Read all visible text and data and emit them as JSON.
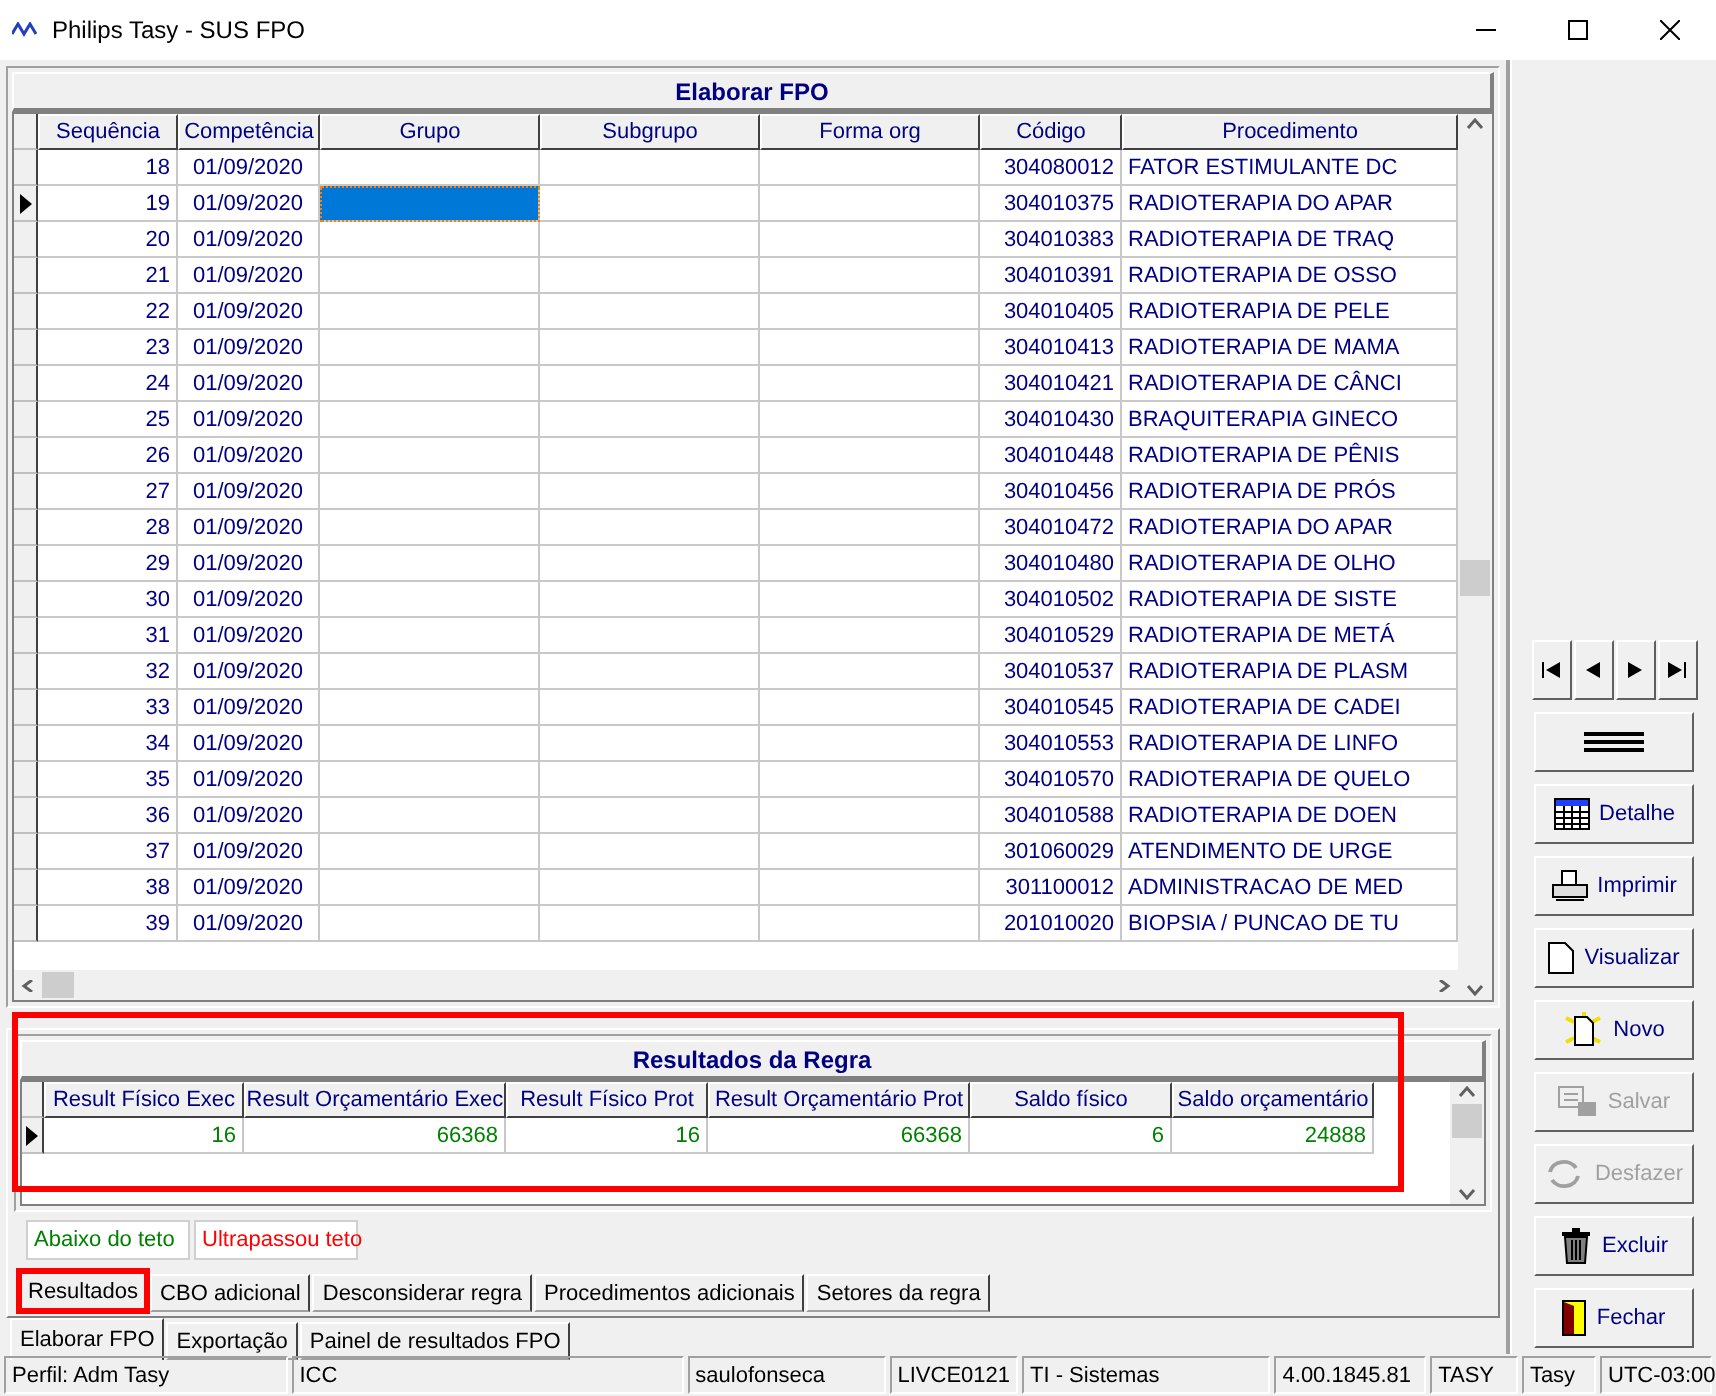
{
  "window": {
    "title": "Philips Tasy - SUS FPO"
  },
  "main_grid": {
    "title": "Elaborar FPO",
    "columns": [
      "Sequência",
      "Competência",
      "Grupo",
      "Subgrupo",
      "Forma org",
      "Código",
      "Procedimento"
    ],
    "rows": [
      {
        "seq": "18",
        "comp": "01/09/2020",
        "code": "304080012",
        "proc": "FATOR ESTIMULANTE DC",
        "current": false
      },
      {
        "seq": "19",
        "comp": "01/09/2020",
        "code": "304010375",
        "proc": "RADIOTERAPIA DO APAR",
        "current": true
      },
      {
        "seq": "20",
        "comp": "01/09/2020",
        "code": "304010383",
        "proc": "RADIOTERAPIA DE TRAQ",
        "current": false
      },
      {
        "seq": "21",
        "comp": "01/09/2020",
        "code": "304010391",
        "proc": "RADIOTERAPIA DE OSSO",
        "current": false
      },
      {
        "seq": "22",
        "comp": "01/09/2020",
        "code": "304010405",
        "proc": "RADIOTERAPIA DE PELE",
        "current": false
      },
      {
        "seq": "23",
        "comp": "01/09/2020",
        "code": "304010413",
        "proc": "RADIOTERAPIA DE MAMA",
        "current": false
      },
      {
        "seq": "24",
        "comp": "01/09/2020",
        "code": "304010421",
        "proc": "RADIOTERAPIA DE CÂNCI",
        "current": false
      },
      {
        "seq": "25",
        "comp": "01/09/2020",
        "code": "304010430",
        "proc": "BRAQUITERAPIA GINECO",
        "current": false
      },
      {
        "seq": "26",
        "comp": "01/09/2020",
        "code": "304010448",
        "proc": "RADIOTERAPIA DE PÊNIS",
        "current": false
      },
      {
        "seq": "27",
        "comp": "01/09/2020",
        "code": "304010456",
        "proc": "RADIOTERAPIA DE PRÓS",
        "current": false
      },
      {
        "seq": "28",
        "comp": "01/09/2020",
        "code": "304010472",
        "proc": "RADIOTERAPIA DO APAR",
        "current": false
      },
      {
        "seq": "29",
        "comp": "01/09/2020",
        "code": "304010480",
        "proc": "RADIOTERAPIA DE OLHO",
        "current": false
      },
      {
        "seq": "30",
        "comp": "01/09/2020",
        "code": "304010502",
        "proc": "RADIOTERAPIA DE SISTE",
        "current": false
      },
      {
        "seq": "31",
        "comp": "01/09/2020",
        "code": "304010529",
        "proc": "RADIOTERAPIA DE METÁ",
        "current": false
      },
      {
        "seq": "32",
        "comp": "01/09/2020",
        "code": "304010537",
        "proc": "RADIOTERAPIA DE PLASM",
        "current": false
      },
      {
        "seq": "33",
        "comp": "01/09/2020",
        "code": "304010545",
        "proc": "RADIOTERAPIA DE CADEI",
        "current": false
      },
      {
        "seq": "34",
        "comp": "01/09/2020",
        "code": "304010553",
        "proc": "RADIOTERAPIA DE LINFO",
        "current": false
      },
      {
        "seq": "35",
        "comp": "01/09/2020",
        "code": "304010570",
        "proc": "RADIOTERAPIA DE QUELO",
        "current": false
      },
      {
        "seq": "36",
        "comp": "01/09/2020",
        "code": "304010588",
        "proc": "RADIOTERAPIA DE DOEN",
        "current": false
      },
      {
        "seq": "37",
        "comp": "01/09/2020",
        "code": "301060029",
        "proc": "ATENDIMENTO DE URGE",
        "current": false
      },
      {
        "seq": "38",
        "comp": "01/09/2020",
        "code": "301100012",
        "proc": "ADMINISTRACAO DE MED",
        "current": false
      },
      {
        "seq": "39",
        "comp": "01/09/2020",
        "code": "201010020",
        "proc": "BIOPSIA / PUNCAO DE TU",
        "current": false
      }
    ]
  },
  "results": {
    "title": "Resultados da Regra",
    "highlighted": true,
    "columns": [
      "Result Físico Exec",
      "Result Orçamentário Exec",
      "Result Físico Prot",
      "Result Orçamentário Prot",
      "Saldo físico",
      "Saldo orçamentário"
    ],
    "rows": [
      {
        "cells": [
          "16",
          "66368",
          "16",
          "66368",
          "6",
          "24888"
        ],
        "current": true
      }
    ]
  },
  "legend": [
    {
      "label": "Abaixo do teto",
      "color": "#008000"
    },
    {
      "label": "Ultrapassou teto",
      "color": "#ff0000"
    }
  ],
  "detail_tabs": [
    {
      "label": "Resultados",
      "selected": true,
      "highlighted": true
    },
    {
      "label": "CBO adicional",
      "selected": false,
      "highlighted": false
    },
    {
      "label": "Desconsiderar regra",
      "selected": false,
      "highlighted": false
    },
    {
      "label": "Procedimentos adicionais",
      "selected": false,
      "highlighted": false
    },
    {
      "label": "Setores da regra",
      "selected": false,
      "highlighted": false
    }
  ],
  "main_tabs": [
    {
      "label": "Elaborar FPO",
      "selected": true
    },
    {
      "label": "Exportação",
      "selected": false
    },
    {
      "label": "Painel de resultados FPO",
      "selected": false
    }
  ],
  "actions": [
    {
      "label": "Detalhe",
      "kind": "detail",
      "disabled": false
    },
    {
      "label": "Imprimir",
      "kind": "print",
      "disabled": false
    },
    {
      "label": "Visualizar",
      "kind": "preview",
      "disabled": false
    },
    {
      "label": "Novo",
      "kind": "new",
      "disabled": false
    },
    {
      "label": "Salvar",
      "kind": "save",
      "disabled": true
    },
    {
      "label": "Desfazer",
      "kind": "undo",
      "disabled": true
    },
    {
      "label": "Excluir",
      "kind": "delete",
      "disabled": false
    },
    {
      "label": "Fechar",
      "kind": "close",
      "disabled": false
    }
  ],
  "status_bar": [
    "Perfil: Adm Tasy",
    "ICC",
    "saulofonseca",
    "LIVCE0121",
    "TI - Sistemas",
    "4.00.1845.81",
    "TASY",
    "Tasy",
    "UTC-03:00"
  ]
}
